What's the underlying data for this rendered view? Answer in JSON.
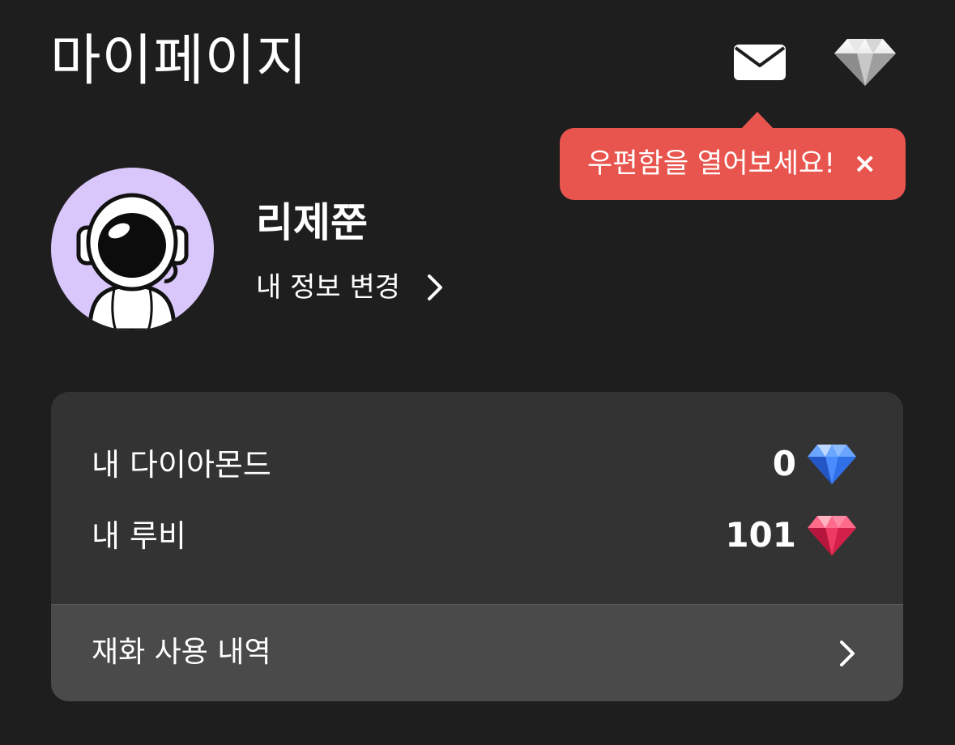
{
  "header": {
    "title": "마이페이지",
    "mail_icon": "envelope-icon",
    "shop_icon": "diamond-icon"
  },
  "tooltip": {
    "text": "우편함을 열어보세요!",
    "close": "×",
    "color": "#e8554e"
  },
  "profile": {
    "avatar_icon": "astronaut-avatar",
    "avatar_bg": "#d9c7fb",
    "name": "리제쭌",
    "edit_label": "내 정보 변경"
  },
  "wallet": {
    "diamond_label": "내 다이아몬드",
    "diamond_value": "0",
    "diamond_icon": "blue-diamond-icon",
    "ruby_label": "내 루비",
    "ruby_value": "101",
    "ruby_icon": "red-ruby-icon",
    "history_label": "재화 사용 내역"
  }
}
